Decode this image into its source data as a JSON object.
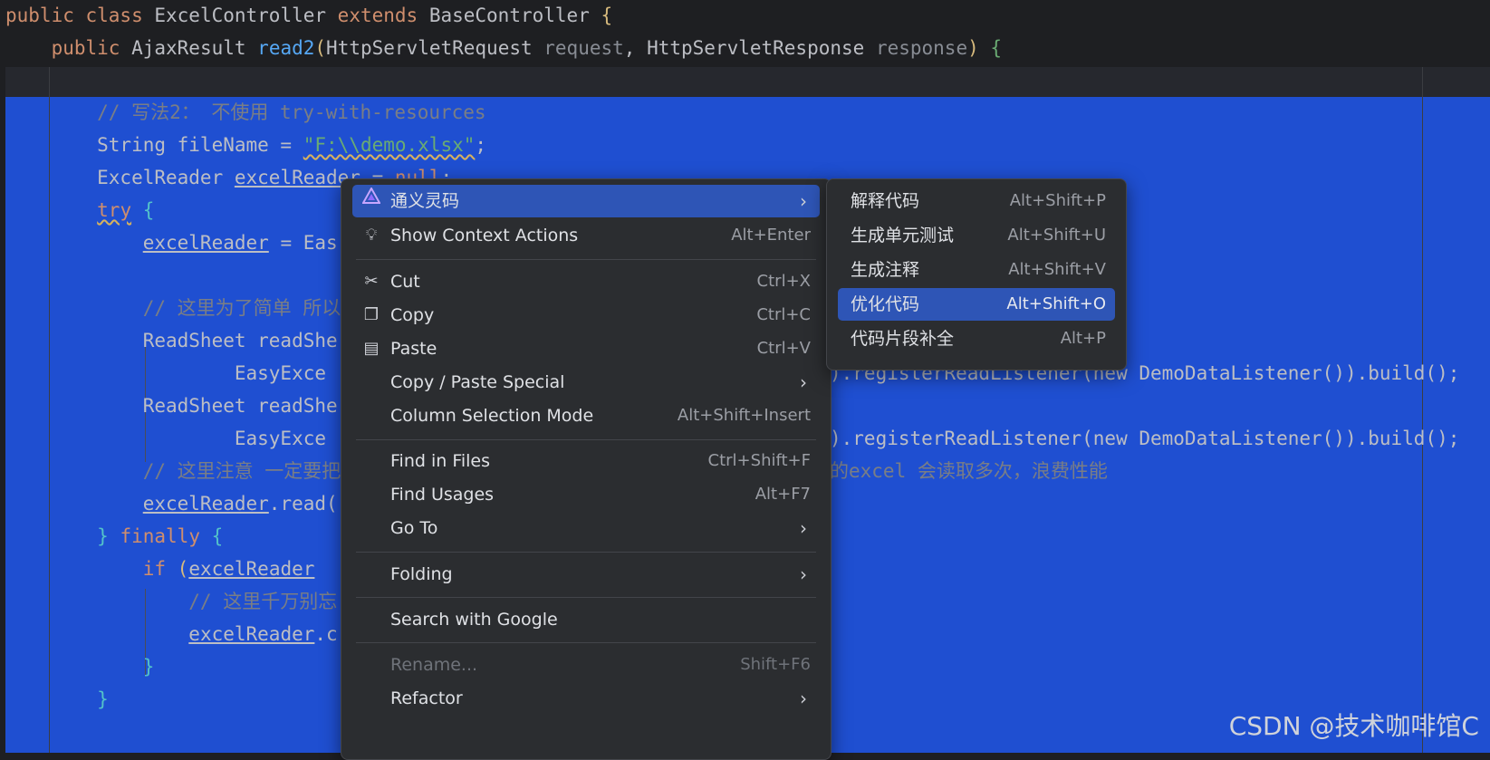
{
  "code": {
    "lines": [
      "public class ExcelController extends BaseController {",
      "    public AjaxResult read2(HttpServletRequest request, HttpServletResponse response) {",
      "",
      "        // 写法2： 不使用 try-with-resources",
      "        String fileName = \"F:\\\\demo.xlsx\";",
      "        ExcelReader excelReader = null;",
      "        try {",
      "            excelReader = Eas",
      "",
      "            // 这里为了简单 所以",
      "            ReadSheet readShe",
      "                    EasyExce",
      "            ReadSheet readShe",
      "                    EasyExce",
      "            // 这里注意 一定要把",
      "            excelReader.read(",
      "        } finally {",
      "            if (excelReader",
      "                // 这里千万别忘",
      "                excelReader.c",
      "            }",
      "        }"
    ],
    "right_fragments": {
      "line11": ").registerReadListener(new DemoDataListener()).build();",
      "line13": ").registerReadListener(new DemoDataListener()).build();",
      "line14": "的excel 会读取多次，浪费性能"
    }
  },
  "context_menu": {
    "items": [
      {
        "label": "通义灵码",
        "shortcut": "",
        "icon": "lingma-icon",
        "submenu": true
      },
      {
        "label": "Show Context Actions",
        "shortcut": "Alt+Enter",
        "icon": "bulb-icon"
      },
      {
        "label": "Cut",
        "shortcut": "Ctrl+X",
        "icon": "scissors-icon"
      },
      {
        "label": "Copy",
        "shortcut": "Ctrl+C",
        "icon": "copy-icon"
      },
      {
        "label": "Paste",
        "shortcut": "Ctrl+V",
        "icon": "paste-icon"
      },
      {
        "label": "Copy / Paste Special",
        "shortcut": "",
        "submenu": true
      },
      {
        "label": "Column Selection Mode",
        "shortcut": "Alt+Shift+Insert"
      },
      {
        "label": "Find in Files",
        "shortcut": "Ctrl+Shift+F"
      },
      {
        "label": "Find Usages",
        "shortcut": "Alt+F7"
      },
      {
        "label": "Go To",
        "shortcut": "",
        "submenu": true
      },
      {
        "label": "Folding",
        "shortcut": "",
        "submenu": true
      },
      {
        "label": "Search with Google",
        "shortcut": ""
      },
      {
        "label": "Rename...",
        "shortcut": "Shift+F6",
        "disabled": true
      },
      {
        "label": "Refactor",
        "shortcut": "",
        "submenu": true
      }
    ]
  },
  "submenu": {
    "items": [
      {
        "label": "解释代码",
        "shortcut": "Alt+Shift+P"
      },
      {
        "label": "生成单元测试",
        "shortcut": "Alt+Shift+U"
      },
      {
        "label": "生成注释",
        "shortcut": "Alt+Shift+V"
      },
      {
        "label": "优化代码",
        "shortcut": "Alt+Shift+O",
        "active": true
      },
      {
        "label": "代码片段补全",
        "shortcut": "Alt+P"
      }
    ]
  },
  "watermark": "CSDN @技术咖啡馆C",
  "colors": {
    "selection": "#1f4fd1",
    "menu_bg": "#2b2d30",
    "active_item": "#2e55b6"
  }
}
